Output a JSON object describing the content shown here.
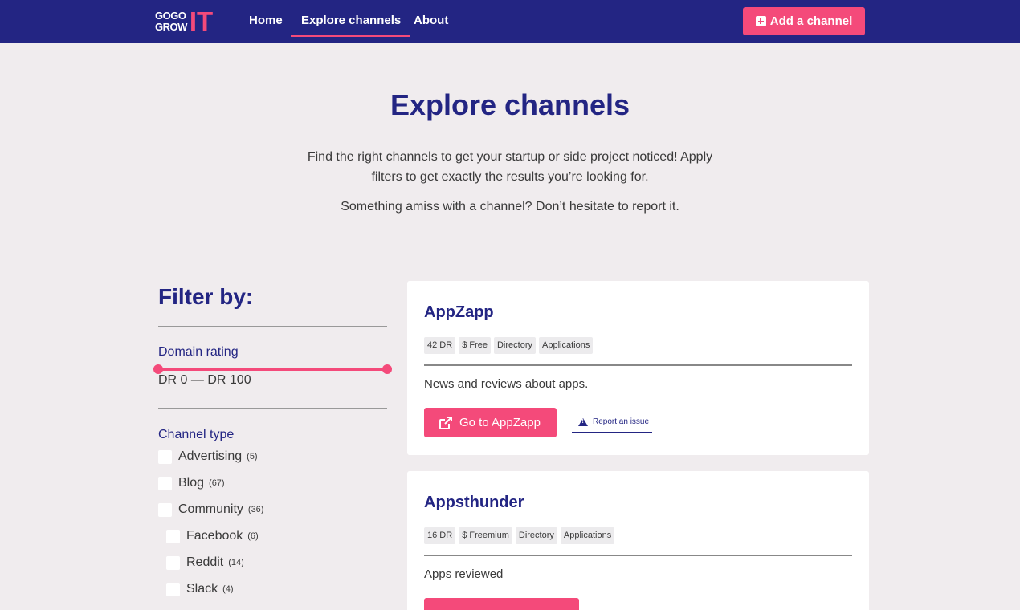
{
  "nav": {
    "logo_line1": "GOGO",
    "logo_line2": "GROW",
    "logo_it": "IT",
    "links": [
      {
        "label": "Home"
      },
      {
        "label": "Explore channels"
      },
      {
        "label": "About"
      }
    ],
    "add_button": "Add a channel",
    "accent": "#f44a7a",
    "bg": "#232583"
  },
  "hero": {
    "title": "Explore channels",
    "line1": "Find the right channels to get your startup or side project noticed! Apply",
    "line2": "filters to get exactly the results you’re looking for.",
    "line3": "Something amiss with a channel? Don’t hesitate to report it."
  },
  "sidebar": {
    "title": "Filter by:",
    "domain_rating": {
      "label": "Domain rating",
      "value": "DR 0 — DR 100",
      "min": 0,
      "max": 100
    },
    "channel_type": {
      "label": "Channel type",
      "items": [
        {
          "label": "Advertising",
          "count": "(5)"
        },
        {
          "label": "Blog",
          "count": "(67)"
        },
        {
          "label": "Community",
          "count": "(36)"
        },
        {
          "label": "Facebook",
          "count": "(6)"
        },
        {
          "label": "Reddit",
          "count": "(14)"
        },
        {
          "label": "Slack",
          "count": "(4)"
        }
      ]
    }
  },
  "cards": [
    {
      "title": "AppZapp",
      "tags": [
        "42 DR",
        "$ Free",
        "Directory",
        "Applications"
      ],
      "description": "News and reviews about apps.",
      "button": "Go to AppZapp",
      "report": "Report an issue"
    },
    {
      "title": "Appsthunder",
      "tags": [
        "16 DR",
        "$ Freemium",
        "Directory",
        "Applications"
      ],
      "description": "Apps reviewed"
    }
  ]
}
